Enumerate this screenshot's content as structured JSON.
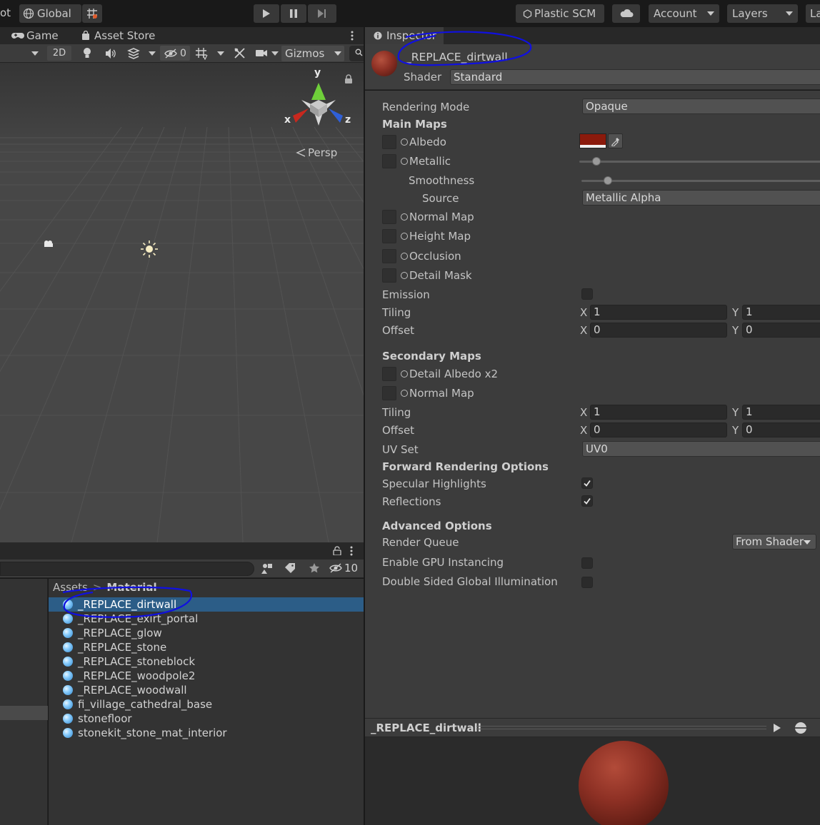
{
  "toolbar": {
    "left_fragment": "ot",
    "global_label": "Global",
    "plastic_label": "Plastic SCM",
    "account_label": "Account",
    "layers_label": "Layers",
    "layout_fragment": "La"
  },
  "scene": {
    "tabs": [
      {
        "label": "Game",
        "icon": "gamepad-icon"
      },
      {
        "label": "Asset Store",
        "icon": "shopping-bag-icon"
      }
    ],
    "toolbar": {
      "mode_2d": "2D",
      "hidden_count": "0",
      "gizmos_label": "Gizmos"
    },
    "gizmo": {
      "x_label": "x",
      "y_label": "y",
      "z_label": "z",
      "projection_label": "Persp"
    }
  },
  "project": {
    "hidden_count": "10",
    "breadcrumb": [
      "Assets",
      "Material"
    ],
    "assets": [
      {
        "name": "_REPLACE_dirtwall",
        "selected": true
      },
      {
        "name": "_REPLACE_exirt_portal",
        "selected": false
      },
      {
        "name": "_REPLACE_glow",
        "selected": false
      },
      {
        "name": "_REPLACE_stone",
        "selected": false
      },
      {
        "name": "_REPLACE_stoneblock",
        "selected": false
      },
      {
        "name": "_REPLACE_woodpole2",
        "selected": false
      },
      {
        "name": "_REPLACE_woodwall",
        "selected": false
      },
      {
        "name": "fi_village_cathedral_base",
        "selected": false
      },
      {
        "name": "stonefloor",
        "selected": false
      },
      {
        "name": "stonekit_stone_mat_interior",
        "selected": false
      }
    ]
  },
  "inspector": {
    "tab_label": "Inspector",
    "material_name": "_REPLACE_dirtwall",
    "shader_label": "Shader",
    "shader_value": "Standard",
    "rendering_mode_label": "Rendering Mode",
    "rendering_mode_value": "Opaque",
    "main_maps_header": "Main Maps",
    "albedo_label": "Albedo",
    "albedo_color": "#8b1a0c",
    "metallic_label": "Metallic",
    "metallic_value": 0.0,
    "smoothness_label": "Smoothness",
    "smoothness_value": 0.1,
    "source_label": "Source",
    "source_value": "Metallic Alpha",
    "normal_map_label": "Normal Map",
    "height_map_label": "Height Map",
    "occlusion_label": "Occlusion",
    "detail_mask_label": "Detail Mask",
    "emission_label": "Emission",
    "emission_checked": false,
    "tiling_label": "Tiling",
    "offset_label": "Offset",
    "axis_x": "X",
    "axis_y": "Y",
    "main_tiling": {
      "x": "1",
      "y": "1"
    },
    "main_offset": {
      "x": "0",
      "y": "0"
    },
    "secondary_maps_header": "Secondary Maps",
    "detail_albedo_label": "Detail Albedo x2",
    "secondary_normal_label": "Normal Map",
    "secondary_tiling": {
      "x": "1",
      "y": "1"
    },
    "secondary_offset": {
      "x": "0",
      "y": "0"
    },
    "uv_set_label": "UV Set",
    "uv_set_value": "UV0",
    "forward_header": "Forward Rendering Options",
    "specular_label": "Specular Highlights",
    "specular_checked": true,
    "reflections_label": "Reflections",
    "reflections_checked": true,
    "advanced_header": "Advanced Options",
    "render_queue_label": "Render Queue",
    "render_queue_value": "From Shader",
    "gpu_instancing_label": "Enable GPU Instancing",
    "gpu_instancing_checked": false,
    "double_sided_label": "Double Sided Global Illumination",
    "double_sided_checked": false
  },
  "preview": {
    "title": "_REPLACE_dirtwall"
  },
  "colors": {
    "annotation_stroke": "#1010e0",
    "selection": "#2c5d87",
    "sphere": "#8d3024"
  }
}
